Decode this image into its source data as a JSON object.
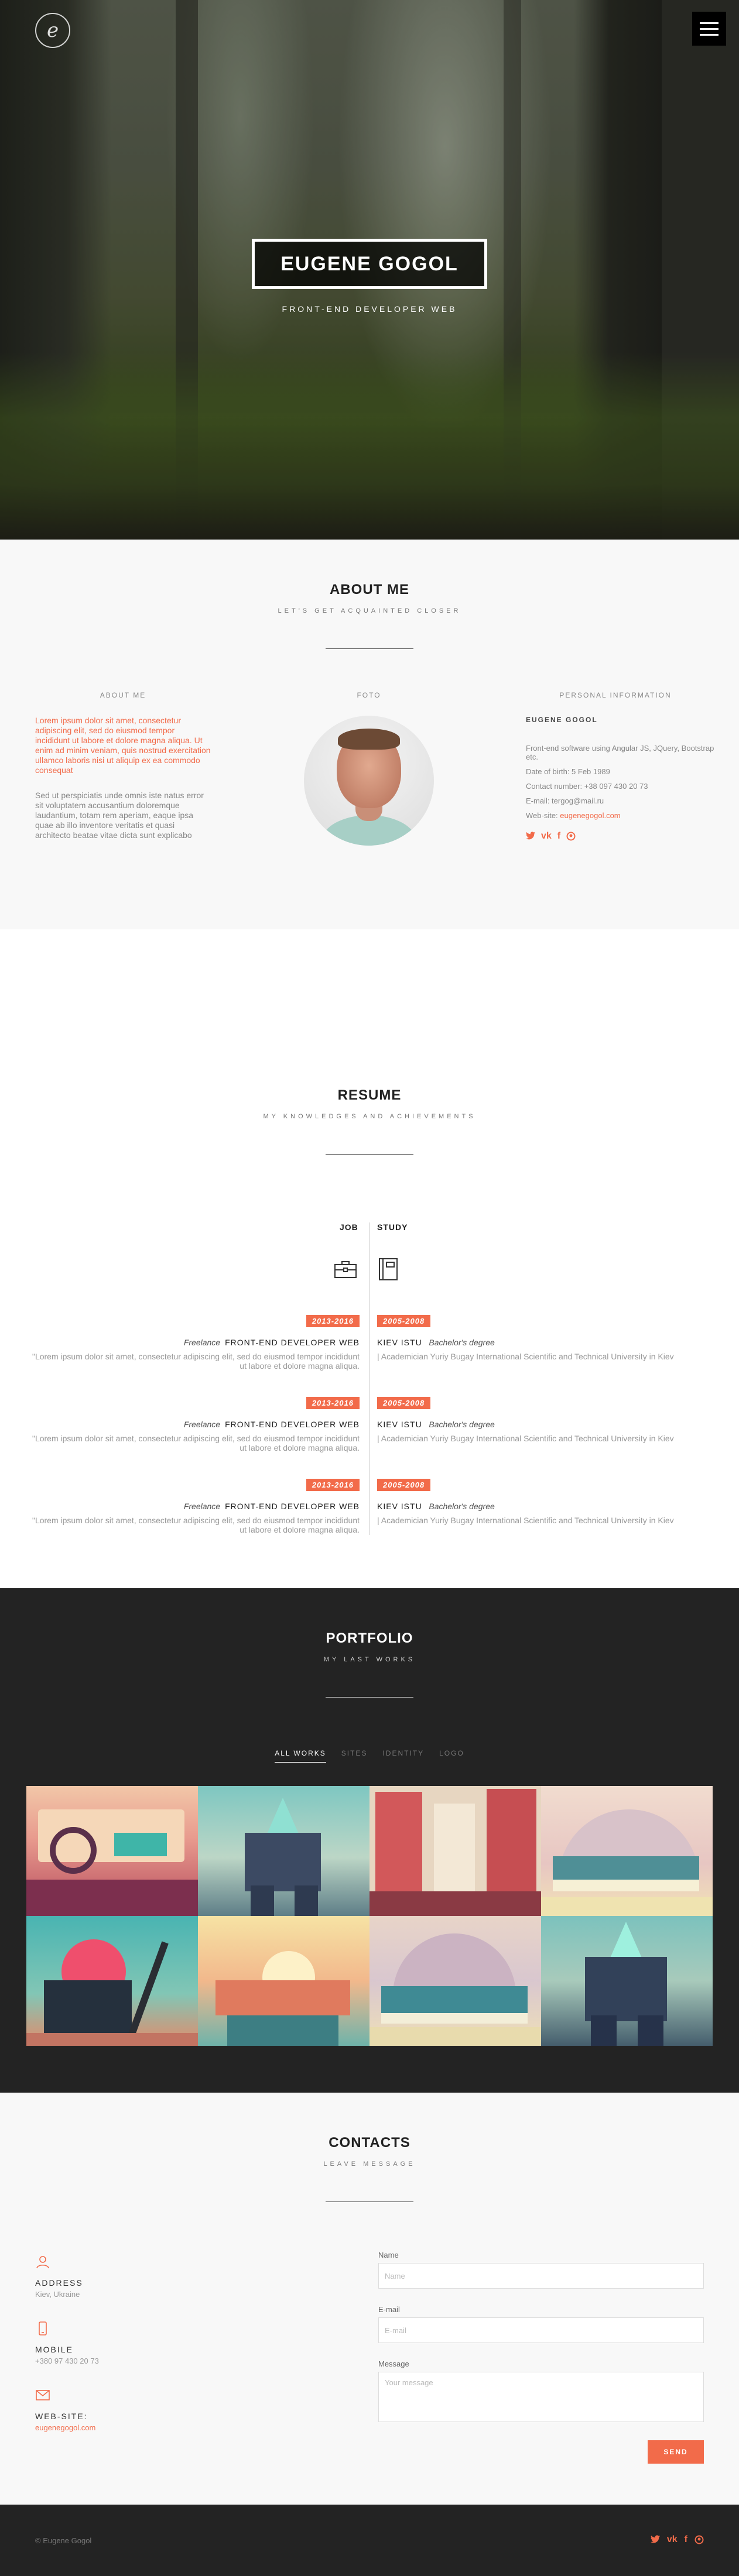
{
  "header": {
    "logo_glyph": "e",
    "name": "EUGENE GOGOL",
    "subtitle": "FRONT-END DEVELOPER WEB"
  },
  "about": {
    "title": "ABOUT ME",
    "subtitle": "LET'S GET ACQUAINTED CLOSER",
    "col_about_head": "ABOUT ME",
    "col_photo_head": "FOTO",
    "col_info_head": "PERSONAL INFORMATION",
    "text_red": "Lorem ipsum dolor sit amet, consectetur adipiscing elit, sed do eiusmod tempor incididunt ut labore et dolore magna aliqua. Ut enim ad minim veniam, quis nostrud exercitation ullamco laboris nisi ut aliquip ex ea commodo consequat",
    "text_grey": "Sed ut perspiciatis unde omnis iste natus error sit voluptatem accusantium doloremque laudantium, totam rem aperiam, eaque ipsa quae ab illo inventore veritatis et quasi architecto beatae vitae dicta sunt explicabo",
    "info": {
      "name": "EUGENE GOGOL",
      "skills": "Front-end software using Angular JS, JQuery, Bootstrap etc.",
      "dob": "Date of birth: 5 Feb 1989",
      "phone": "Contact number: +38 097 430 20 73",
      "email": "E-mail: tergog@mail.ru",
      "website_label": "Web-site: ",
      "website": "eugenegogol.com"
    }
  },
  "resume": {
    "title": "RESUME",
    "subtitle": "MY KNOWLEDGES AND ACHIEVEMENTS",
    "job_label": "JOB",
    "study_label": "STUDY",
    "jobs": [
      {
        "years": "2013-2016",
        "type": "Freelance",
        "role": "FRONT-END DEVELOPER WEB",
        "text": "\"Lorem ipsum dolor sit amet, consectetur adipiscing elit, sed do eiusmod tempor incididunt ut labore et dolore magna aliqua."
      },
      {
        "years": "2013-2016",
        "type": "Freelance",
        "role": "FRONT-END DEVELOPER WEB",
        "text": "\"Lorem ipsum dolor sit amet, consectetur adipiscing elit, sed do eiusmod tempor incididunt ut labore et dolore magna aliqua."
      },
      {
        "years": "2013-2016",
        "type": "Freelance",
        "role": "FRONT-END DEVELOPER WEB",
        "text": "\"Lorem ipsum dolor sit amet, consectetur adipiscing elit, sed do eiusmod tempor incididunt ut labore et dolore magna aliqua."
      }
    ],
    "studies": [
      {
        "years": "2005-2008",
        "school": "KIEV ISTU",
        "degree": "Bachelor's degree",
        "text": "| Academician Yuriy Bugay International Scientific and Technical University in Kiev"
      },
      {
        "years": "2005-2008",
        "school": "KIEV ISTU",
        "degree": "Bachelor's degree",
        "text": "| Academician Yuriy Bugay International Scientific and Technical University in Kiev"
      },
      {
        "years": "2005-2008",
        "school": "KIEV ISTU",
        "degree": "Bachelor's degree",
        "text": "| Academician Yuriy Bugay International Scientific and Technical University in Kiev"
      }
    ]
  },
  "portfolio": {
    "title": "PORTFOLIO",
    "subtitle": "MY LAST WORKS",
    "filters": [
      "ALL WORKS",
      "SITES",
      "IDENTITY",
      "LOGO"
    ]
  },
  "contacts": {
    "title": "CONTACTS",
    "subtitle": "LEAVE MESSAGE",
    "address_label": "ADDRESS",
    "address": "Kiev, Ukraine",
    "mobile_label": "MOBILE",
    "mobile": "+380 97 430 20 73",
    "web_label": "WEB-SITE:",
    "web": "eugenegogol.com",
    "form": {
      "name_label": "Name",
      "name_placeholder": "Name",
      "email_label": "E-mail",
      "email_placeholder": "E-mail",
      "message_label": "Message",
      "message_placeholder": "Your message",
      "send": "SEND"
    }
  },
  "footer": {
    "copyright": "© Eugene Gogol"
  },
  "colors": {
    "accent": "#f26b4a",
    "dark": "#232323",
    "light_bg": "#f8f8f8"
  },
  "icons": [
    "menu-icon",
    "twitter-icon",
    "vk-icon",
    "facebook-icon",
    "github-icon",
    "briefcase-icon",
    "book-icon",
    "location-icon",
    "phone-icon",
    "email-icon"
  ]
}
